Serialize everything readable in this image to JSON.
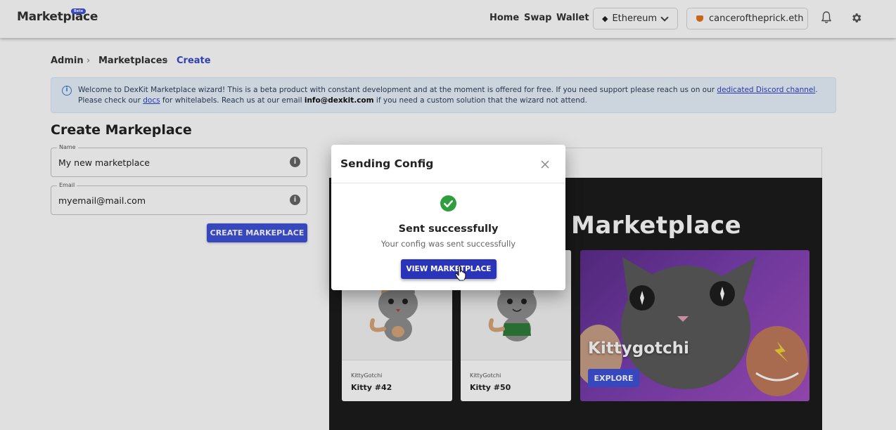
{
  "header": {
    "logo": "Marketplace",
    "logo_badge": "Beta",
    "nav": [
      "Home",
      "Swap",
      "Wallet"
    ],
    "network": "Ethereum",
    "account": "canceroftheprick.eth"
  },
  "breadcrumb": [
    "Admin",
    "Marketplaces",
    "Create"
  ],
  "alert": {
    "line1_prefix": "Welcome to DexKit Marketplace wizard! This is a beta product with constant development and at the moment is offered for free. If you need support please reach us on our ",
    "line1_link": "dedicated Discord channel",
    "line1_suffix": ".",
    "line2_prefix": "Please check our ",
    "line2_link": "docs",
    "line2_mid": " for whitelabels. Reach us at our email ",
    "line2_email": "info@dexkit.com",
    "line2_suffix": " if you need a custom solution that the wizard not attend."
  },
  "form": {
    "title": "Create Markeplace",
    "name_label": "Name",
    "name_value": "My new marketplace",
    "email_label": "Email",
    "email_value": "myemail@mail.com",
    "submit": "CREATE MARKEPLACE"
  },
  "preview": {
    "title": "Marketplace",
    "cards": [
      {
        "collection": "KittyGotchi",
        "name": "Kitty #42"
      },
      {
        "collection": "KittyGotchi",
        "name": "Kitty #50"
      }
    ],
    "hero_title": "Kittygotchi",
    "hero_button": "EXPLORE"
  },
  "dialog": {
    "title": "Sending Config",
    "status_title": "Sent successfully",
    "status_text": "Your config was sent successfully",
    "button": "VIEW MARKETPLACE"
  },
  "colors": {
    "primary": "#3f51d8",
    "dialog_button": "#2a34b8",
    "success": "#2e9e3e",
    "preview_bg": "#1c1c1c"
  }
}
